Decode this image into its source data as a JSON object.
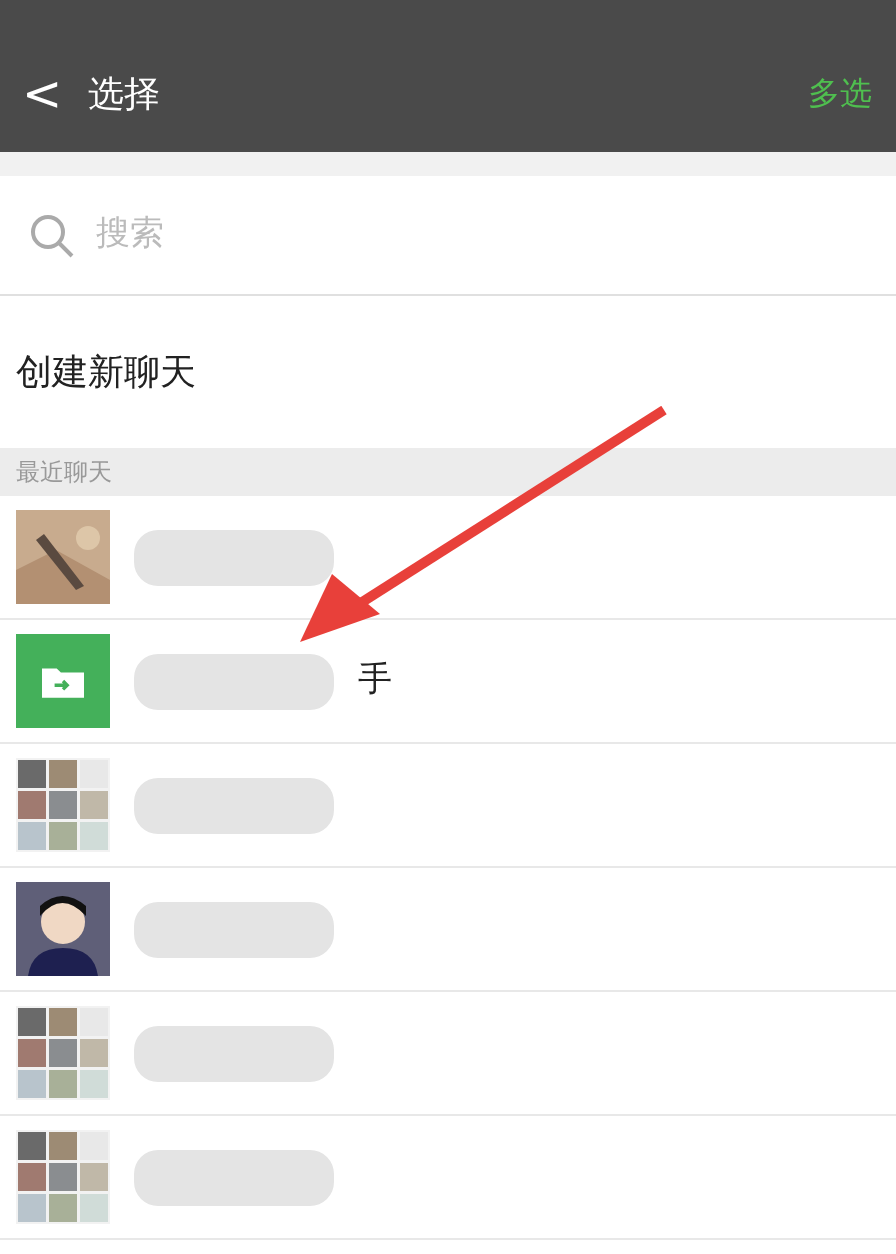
{
  "nav": {
    "back": "<",
    "title": "选择",
    "action": "多选"
  },
  "search": {
    "placeholder": "搜索"
  },
  "create_chat": "创建新聊天",
  "section": "最近聊天",
  "chats": [
    {
      "kind": "picture"
    },
    {
      "kind": "file",
      "name_tail": "手"
    },
    {
      "kind": "grid"
    },
    {
      "kind": "person"
    },
    {
      "kind": "grid"
    },
    {
      "kind": "grid"
    }
  ]
}
